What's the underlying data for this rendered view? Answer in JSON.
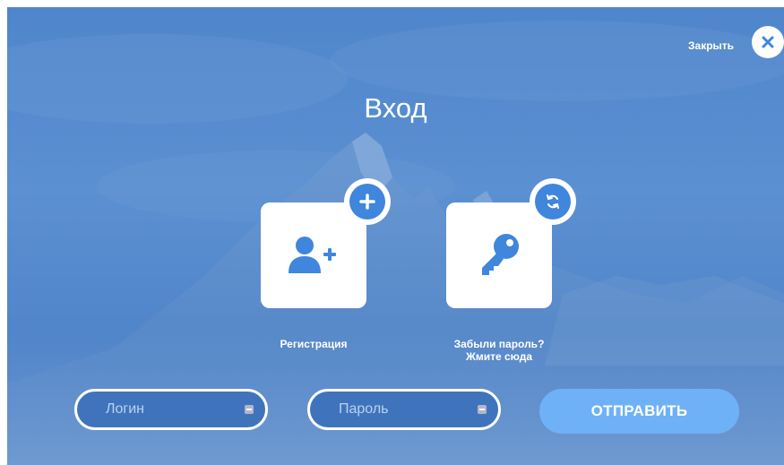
{
  "header": {
    "close_label": "Закрыть",
    "close_icon": "x-icon"
  },
  "title": "Вход",
  "cards": [
    {
      "label": "Регистрация",
      "icon": "user-plus-icon",
      "badge_icon": "plus-icon"
    },
    {
      "label_line1": "Забыли пароль?",
      "label_line2": "Жмите сюда",
      "icon": "key-icon",
      "badge_icon": "refresh-icon"
    }
  ],
  "form": {
    "login_placeholder": "Логин",
    "login_value": "",
    "password_placeholder": "Пароль",
    "password_value": "",
    "submit_label": "ОТПРАВИТЬ"
  },
  "colors": {
    "background": "#5b90d2",
    "accent": "#3f86dc",
    "submit": "#6eb1f7",
    "field_bg": "#3f74bd",
    "white": "#ffffff"
  }
}
